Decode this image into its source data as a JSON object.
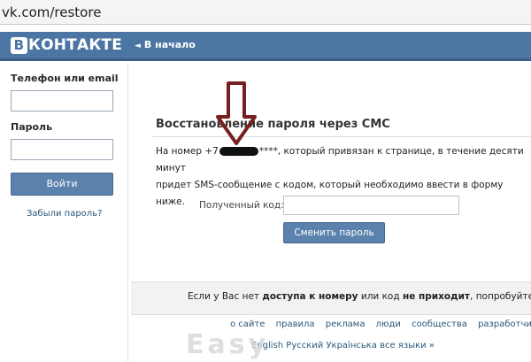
{
  "browser": {
    "url": "vk.com/restore"
  },
  "header": {
    "logo_letter": "В",
    "logo_text": "КОНТАКТЕ",
    "home_link": "В начало"
  },
  "login": {
    "phone_label": "Телефон или email",
    "password_label": "Пароль",
    "login_button": "Войти",
    "forgot_link": "Забыли пароль?"
  },
  "restore": {
    "title": "Восстановление пароля через СМС",
    "info_prefix": "На номер +7",
    "info_suffix": "****, который привязан к странице, в течение десяти минут",
    "info_line2": "придет SMS-сообщение с кодом, который необходимо ввести в форму ниже.",
    "code_label": "Полученный код:",
    "submit_button": "Сменить пароль"
  },
  "help": {
    "prefix": "Если у Вас нет ",
    "bold1": "доступа к номеру",
    "middle": " или код ",
    "bold2": "не приходит",
    "suffix": ", попробуйте на"
  },
  "footer_links": [
    "о сайте",
    "правила",
    "реклама",
    "люди",
    "сообщества",
    "разработчик"
  ],
  "language_line": "English  Русский  Українська  все языки »",
  "watermark": "Easy",
  "colors": {
    "header": "#4c75a3",
    "button": "#5b82ad",
    "link": "#2b587a",
    "arrow": "#7a1f1f"
  }
}
